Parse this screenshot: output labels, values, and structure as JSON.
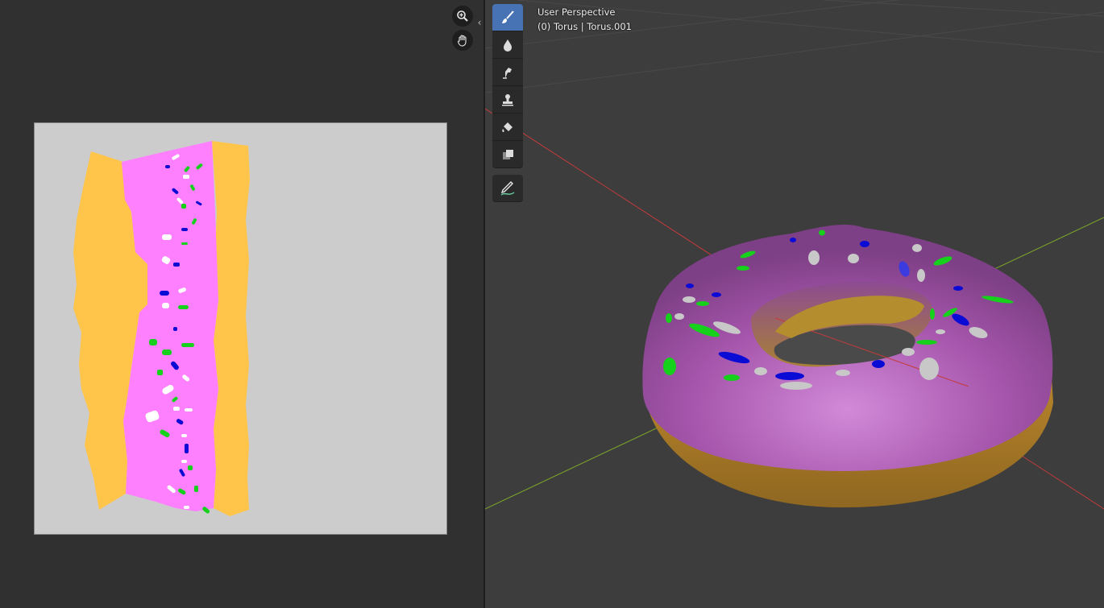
{
  "viewport": {
    "perspective_label": "User Perspective",
    "object_label": "(0) Torus | Torus.001"
  },
  "image_editor": {
    "nav_buttons": [
      "zoom-icon",
      "pan-hand-icon"
    ]
  },
  "toolbar": {
    "tools": [
      "draw-brush-icon",
      "soften-icon",
      "smear-icon",
      "clone-icon",
      "fill-icon",
      "mask-icon",
      "annotate-icon"
    ],
    "active_tool": "draw-brush-icon"
  },
  "colors": {
    "icing": "#ff80ff",
    "dough": "#ffc54a",
    "sprinkle_green": "#15d11b",
    "sprinkle_blue": "#0b0bd6",
    "sprinkle_white": "#ffffff",
    "selection": "#4772b3",
    "x_axis": "#c43b3b",
    "y_axis": "#7fa82a"
  }
}
